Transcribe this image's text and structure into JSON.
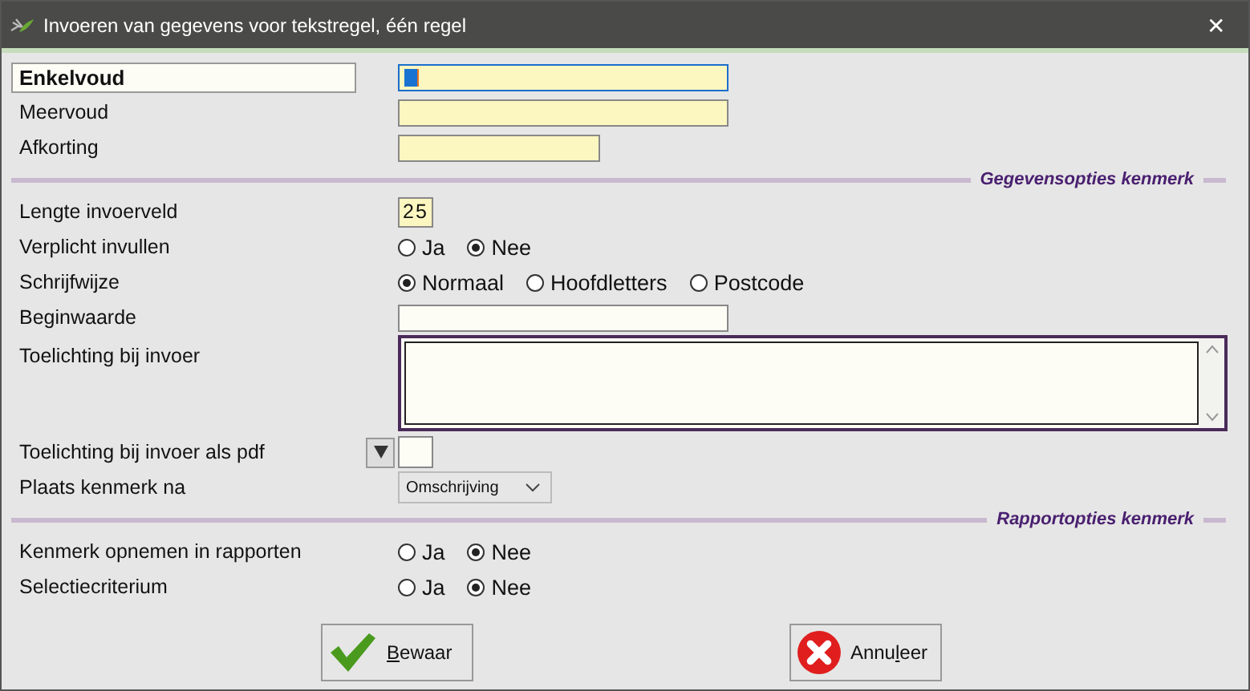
{
  "window": {
    "title": "Invoeren van gegevens voor tekstregel, één regel",
    "close": "✕"
  },
  "rows": [
    {
      "kind": "text",
      "label": "Enkelvoud",
      "active": true,
      "required": true,
      "focused": true
    },
    {
      "kind": "text",
      "label": "Meervoud",
      "active": false,
      "required": true,
      "focused": false
    },
    {
      "kind": "short_text",
      "label": "Afkorting",
      "active": false,
      "required": true,
      "focused": false
    },
    {
      "kind": "section",
      "label": "Gegevensopties kenmerk"
    },
    {
      "kind": "number",
      "label": "Lengte invoerveld",
      "value": "25"
    },
    {
      "kind": "radio",
      "label": "Verplicht invullen",
      "options": [
        {
          "label": "Ja",
          "selected": false
        },
        {
          "label": "Nee",
          "selected": true
        }
      ]
    },
    {
      "kind": "radio",
      "label": "Schrijfwijze",
      "options": [
        {
          "label": "Normaal",
          "selected": true
        },
        {
          "label": "Hoofdletters",
          "selected": false
        },
        {
          "label": "Postcode",
          "selected": false
        }
      ]
    },
    {
      "kind": "text",
      "label": "Beginwaarde",
      "active": false,
      "required": false,
      "focused": false
    },
    {
      "kind": "textarea",
      "label": "Toelichting bij invoer"
    },
    {
      "kind": "file",
      "label": "Toelichting bij invoer als pdf"
    },
    {
      "kind": "select",
      "label": "Plaats kenmerk na",
      "value": "Omschrijving"
    },
    {
      "kind": "section",
      "label": "Rapportopties kenmerk"
    },
    {
      "kind": "radio",
      "label": "Kenmerk opnemen in rapporten",
      "options": [
        {
          "label": "Ja",
          "selected": false
        },
        {
          "label": "Nee",
          "selected": true
        }
      ]
    },
    {
      "kind": "radio",
      "label": "Selectiecriterium",
      "options": [
        {
          "label": "Ja",
          "selected": false
        },
        {
          "label": "Nee",
          "selected": true
        }
      ]
    }
  ],
  "buttons": [
    {
      "kind": "save",
      "key": "B",
      "after": "ewaar"
    },
    {
      "kind": "cancel",
      "before": "Annu",
      "key": "l",
      "after": "eer"
    }
  ]
}
